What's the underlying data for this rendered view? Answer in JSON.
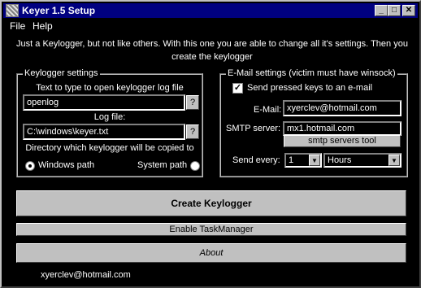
{
  "window": {
    "title": "Keyer 1.5 Setup",
    "minimize": "_",
    "maximize": "□",
    "close": "✕"
  },
  "menu": {
    "file": "File",
    "help": "Help"
  },
  "intro": {
    "line1": "Just a Keylogger, but not like others. With this one you are able to change all it's settings. Then you",
    "line2": "create the keylogger"
  },
  "keylogger_settings": {
    "title": "Keylogger settings",
    "open_text_label": "Text to type to open keylogger log file",
    "open_text_value": "openlog",
    "help_button": "?",
    "logfile_label": "Log file:",
    "logfile_value": "C:\\windows\\keyer.txt",
    "directory_label": "Directory which keylogger will be copied to",
    "windows_path": "Windows path",
    "system_path": "System path",
    "selected": "windows"
  },
  "email_settings": {
    "title": "E-Mail settings (victim must have winsock)",
    "send_keys_label": "Send pressed keys to an e-mail",
    "send_keys_checked": true,
    "email_label": "E-Mail:",
    "email_value": "xyerclev@hotmail.com",
    "smtp_label": "SMTP server:",
    "smtp_value": "mx1.hotmail.com",
    "smtp_tool_button": "smtp servers tool",
    "send_every_label": "Send every:",
    "send_every_value": "1",
    "send_every_unit": "Hours"
  },
  "actions": {
    "create": "Create Keylogger",
    "enable_taskmanager": "Enable TaskManager",
    "about": "About"
  },
  "footer": {
    "author": "xyerclev@hotmail.com"
  }
}
